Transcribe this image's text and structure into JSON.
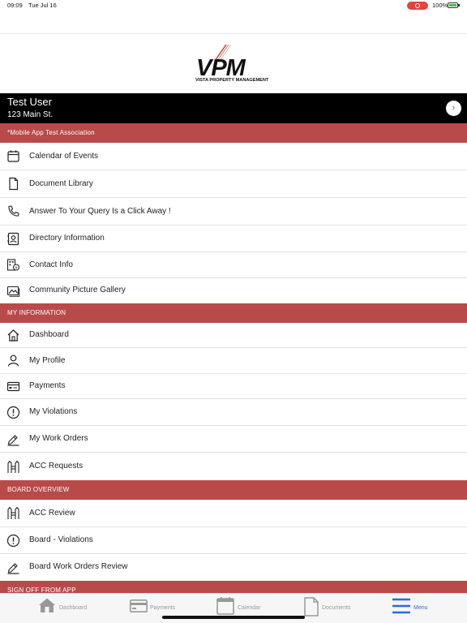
{
  "status_bar": {
    "time": "09:09",
    "date": "Tue Jul 16",
    "battery": "100%"
  },
  "logo": {
    "text": "VPM",
    "subtitle": "VISTA PROPERTY MANAGEMENT"
  },
  "user": {
    "name": "Test User",
    "address": "123 Main St."
  },
  "association": {
    "label": "*Mobile App Test Association"
  },
  "association_items": [
    {
      "label": "Calendar of Events",
      "icon": "calendar-icon"
    },
    {
      "label": "Document Library",
      "icon": "document-icon"
    },
    {
      "label": "Answer To Your Query Is a Click Away !",
      "icon": "phone-icon"
    },
    {
      "label": "Directory Information",
      "icon": "contact-card-icon"
    },
    {
      "label": "Contact Info",
      "icon": "building-info-icon"
    },
    {
      "label": "Community Picture Gallery",
      "icon": "image-gallery-icon"
    }
  ],
  "my_information": {
    "header": "MY INFORMATION",
    "items": [
      {
        "label": "Dashboard",
        "icon": "home-icon"
      },
      {
        "label": "My Profile",
        "icon": "person-icon"
      },
      {
        "label": "Payments",
        "icon": "payment-card-icon"
      },
      {
        "label": "My Violations",
        "icon": "alert-icon"
      },
      {
        "label": "My Work Orders",
        "icon": "work-order-icon"
      },
      {
        "label": "ACC Requests",
        "icon": "acc-icon"
      }
    ]
  },
  "board_overview": {
    "header": "BOARD OVERVIEW",
    "items": [
      {
        "label": "ACC Review",
        "icon": "acc-icon"
      },
      {
        "label": "Board - Violations",
        "icon": "alert-icon"
      },
      {
        "label": "Board Work Orders Review",
        "icon": "work-order-icon"
      }
    ]
  },
  "sign_off": {
    "header": "SIGN OFF FROM APP"
  },
  "tab_bar": {
    "tabs": [
      {
        "label": "Dashboard",
        "icon": "home-icon",
        "active": false
      },
      {
        "label": "Payments",
        "icon": "payment-card-icon",
        "active": false
      },
      {
        "label": "Calendar",
        "icon": "calendar-icon",
        "active": false
      },
      {
        "label": "Documents",
        "icon": "document-icon",
        "active": false
      },
      {
        "label": "Menu",
        "icon": "hamburger-menu-icon",
        "active": true
      }
    ],
    "active_color": "#2f6bd6"
  },
  "colors": {
    "section_header": "#b94a4a",
    "user_bar": "#000000"
  }
}
